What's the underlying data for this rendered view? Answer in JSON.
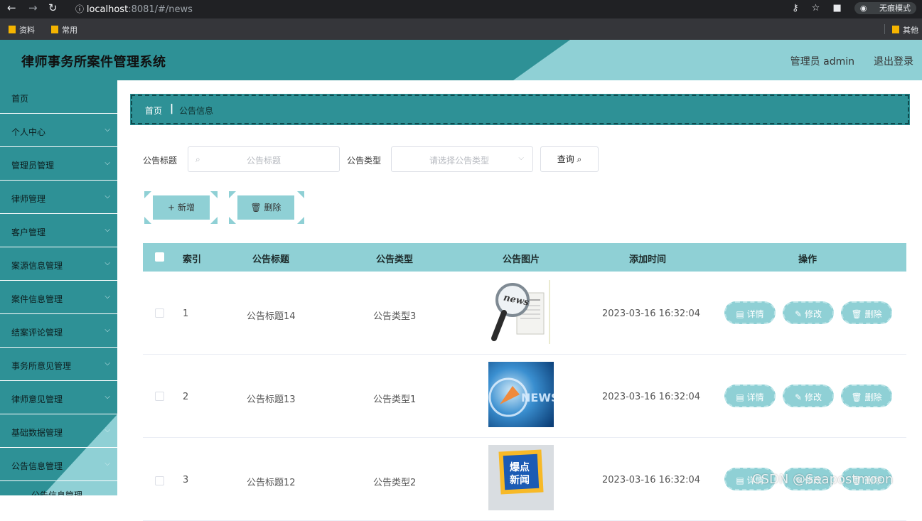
{
  "browser": {
    "url_host": "localhost",
    "url_path": ":8081/#/news",
    "incognito_label": "无痕模式",
    "bookmarks": [
      "资料",
      "常用"
    ],
    "bookmark_right": "其他"
  },
  "app": {
    "title": "律师事务所案件管理系统",
    "user": "管理员 admin",
    "logout": "退出登录",
    "brand_color": "#2e9196",
    "accent_color": "#8fd0d5"
  },
  "sidebar": {
    "items": [
      {
        "label": "首页",
        "chevron": false
      },
      {
        "label": "个人中心",
        "chevron": true
      },
      {
        "label": "管理员管理",
        "chevron": true
      },
      {
        "label": "律师管理",
        "chevron": true
      },
      {
        "label": "客户管理",
        "chevron": true
      },
      {
        "label": "案源信息管理",
        "chevron": true
      },
      {
        "label": "案件信息管理",
        "chevron": true
      },
      {
        "label": "结案评论管理",
        "chevron": true
      },
      {
        "label": "事务所意见管理",
        "chevron": true
      },
      {
        "label": "律师意见管理",
        "chevron": true
      },
      {
        "label": "基础数据管理",
        "chevron": true
      },
      {
        "label": "公告信息管理",
        "chevron": true
      }
    ],
    "sub_item": "公告信息管理"
  },
  "breadcrumb": {
    "home": "首页",
    "sep": "|",
    "current": "公告信息"
  },
  "filters": {
    "title_label": "公告标题",
    "title_placeholder": "公告标题",
    "type_label": "公告类型",
    "type_placeholder": "请选择公告类型",
    "query_button": "查询"
  },
  "actions": {
    "add": "新增",
    "delete": "删除"
  },
  "table": {
    "headers": [
      "索引",
      "公告标题",
      "公告类型",
      "公告图片",
      "添加时间",
      "操作"
    ],
    "rows": [
      {
        "index": "1",
        "title": "公告标题14",
        "type": "公告类型3",
        "time": "2023-03-16 16:32:04",
        "image": "news-magnifier-icon"
      },
      {
        "index": "2",
        "title": "公告标题13",
        "type": "公告类型1",
        "time": "2023-03-16 16:32:04",
        "image": "news-globe-icon"
      },
      {
        "index": "3",
        "title": "公告标题12",
        "type": "公告类型2",
        "time": "2023-03-16 16:32:04",
        "image": "breaking-news-icon"
      }
    ],
    "row_ops": {
      "detail": "详情",
      "edit": "修改",
      "delete": "删除"
    }
  },
  "thumb_text": {
    "news": "news",
    "news2": "NEWS",
    "bd1": "爆点",
    "bd2": "新闻"
  },
  "watermark": "CSDN @Seapostmoon"
}
